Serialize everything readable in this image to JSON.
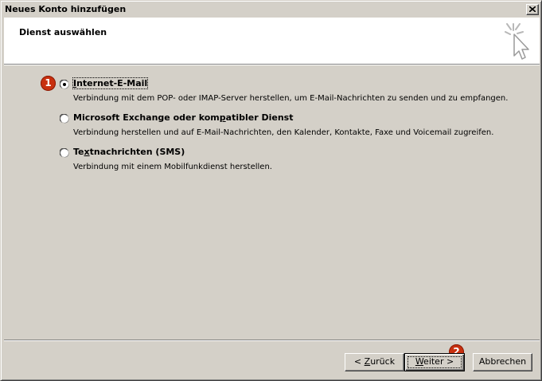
{
  "window": {
    "title": "Neues Konto hinzufügen"
  },
  "header": {
    "title": "Dienst auswählen",
    "icon": "wizard-cursor-icon"
  },
  "options": [
    {
      "label_pre": "",
      "label_accel": "I",
      "label_post": "nternet-E-Mail",
      "description": "Verbindung mit dem POP- oder IMAP-Server herstellen, um E-Mail-Nachrichten zu senden und zu empfangen.",
      "selected": true
    },
    {
      "label_pre": "Microsoft Exchange oder kom",
      "label_accel": "p",
      "label_post": "atibler Dienst",
      "description": "Verbindung herstellen und auf E-Mail-Nachrichten, den Kalender, Kontakte, Faxe und Voicemail zugreifen.",
      "selected": false
    },
    {
      "label_pre": "Te",
      "label_accel": "x",
      "label_post": "tnachrichten (SMS)",
      "description": "Verbindung mit einem Mobilfunkdienst herstellen.",
      "selected": false
    }
  ],
  "badges": {
    "first": "1",
    "second": "2",
    "color": "#c8300f"
  },
  "buttons": {
    "back_pre": "< ",
    "back_accel": "Z",
    "back_post": "urück",
    "next_pre": "",
    "next_accel": "W",
    "next_post": "eiter >",
    "cancel": "Abbrechen"
  }
}
